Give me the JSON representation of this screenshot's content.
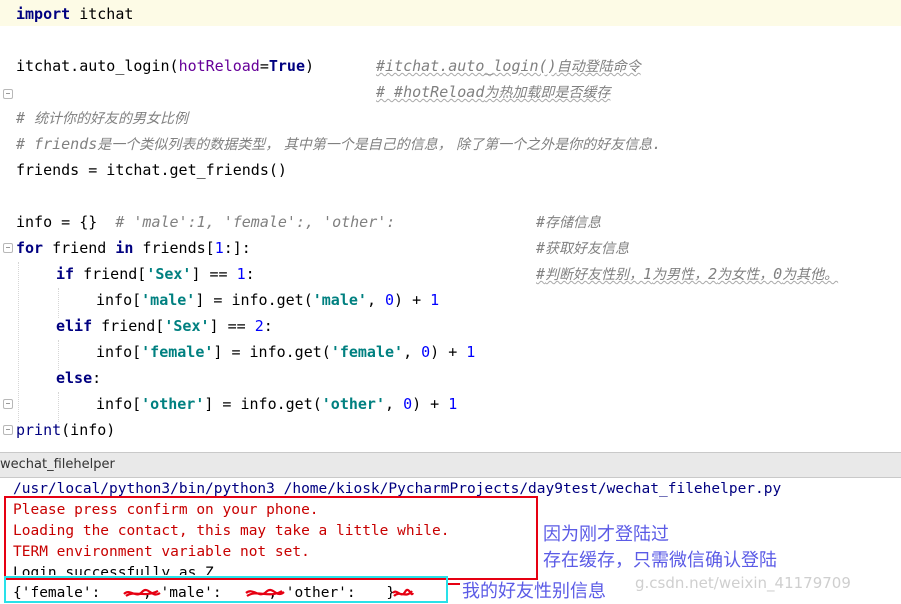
{
  "editor": {
    "lines": {
      "l1": {
        "kw": "import",
        "rest": " itchat"
      },
      "l3": {
        "a": "itchat.auto_login(",
        "param": "hotReload",
        "eq": "=",
        "tru": "True",
        "b": ")",
        "cmt_code": "#itchat.auto_login()",
        "cmt_cn": "自动登陆命令"
      },
      "l4": {
        "cmt_code": "# #hotReload",
        "cmt_cn": "为热加载即是否缓存"
      },
      "l5": {
        "cmt_code": "# ",
        "cmt_cn": "统计你的好友的男女比例"
      },
      "l6": {
        "cmt_code": "# friends",
        "cmt_cn": "是一个类似列表的数据类型， 其中第一个是自己的信息， 除了第一个之外是你的好友信息",
        "cmt_end": "."
      },
      "l7": {
        "text": "friends = itchat.get_friends()"
      },
      "l9": {
        "a": "info = {}  ",
        "cmt_code": "# 'male':1, 'female':, 'other':",
        "cmt2_code": "#",
        "cmt2_cn": "存储信息"
      },
      "l10": {
        "kw": "for",
        "a": " friend ",
        "kw2": "in",
        "b": " friends[",
        "n": "1",
        "c": ":]:",
        "cmt_code": "#",
        "cmt_cn": "获取好友信息"
      },
      "l11": {
        "kw": "if",
        "a": " friend[",
        "s": "'Sex'",
        "b": "] == ",
        "n": "1",
        "c": ":",
        "cmt_code": "#",
        "cmt_cn1": "判断好友性别，",
        "n1": "1",
        "cmt_cn2": "为男性，",
        "n2": "2",
        "cmt_cn3": "为女性，",
        "n3": "0",
        "cmt_cn4": "为其他。"
      },
      "l12": {
        "a": "info[",
        "s": "'male'",
        "b": "] = info.get(",
        "s2": "'male'",
        "c": ", ",
        "n": "0",
        "d": ") + ",
        "n2": "1"
      },
      "l13": {
        "kw": "elif",
        "a": " friend[",
        "s": "'Sex'",
        "b": "] == ",
        "n": "2",
        "c": ":"
      },
      "l14": {
        "a": "info[",
        "s": "'female'",
        "b": "] = info.get(",
        "s2": "'female'",
        "c": ", ",
        "n": "0",
        "d": ") + ",
        "n2": "1"
      },
      "l15": {
        "kw": "else",
        "c": ":"
      },
      "l16": {
        "a": "info[",
        "s": "'other'",
        "b": "] = info.get(",
        "s2": "'other'",
        "c": ", ",
        "n": "0",
        "d": ") + ",
        "n2": "1"
      },
      "l17": {
        "a": "print",
        "b": "(info)"
      }
    }
  },
  "run_tab": {
    "title": "wechat_filehelper"
  },
  "console": {
    "command": "/usr/local/python3/bin/python3 /home/kiosk/PycharmProjects/day9test/wechat_filehelper.py",
    "stderr": [
      "Please press confirm on your phone.",
      "Loading the contact, this may take a little while.",
      "TERM environment variable not set."
    ],
    "stdout_partial": "Login successfully as Z",
    "result": {
      "p1": "{'female': ",
      "p2": ", 'male': ",
      "p3": ", 'other': ",
      "p4": "}"
    }
  },
  "annotations": {
    "note1": "因为刚才登陆过",
    "note2": "存在缓存，只需微信确认登陆",
    "note3": "我的好友性别信息"
  },
  "watermark": "g.csdn.net/weixin_41179709",
  "colors": {
    "red_box": "#e60012",
    "cyan_box": "#29e1e9",
    "note_text": "#5b5be6"
  }
}
